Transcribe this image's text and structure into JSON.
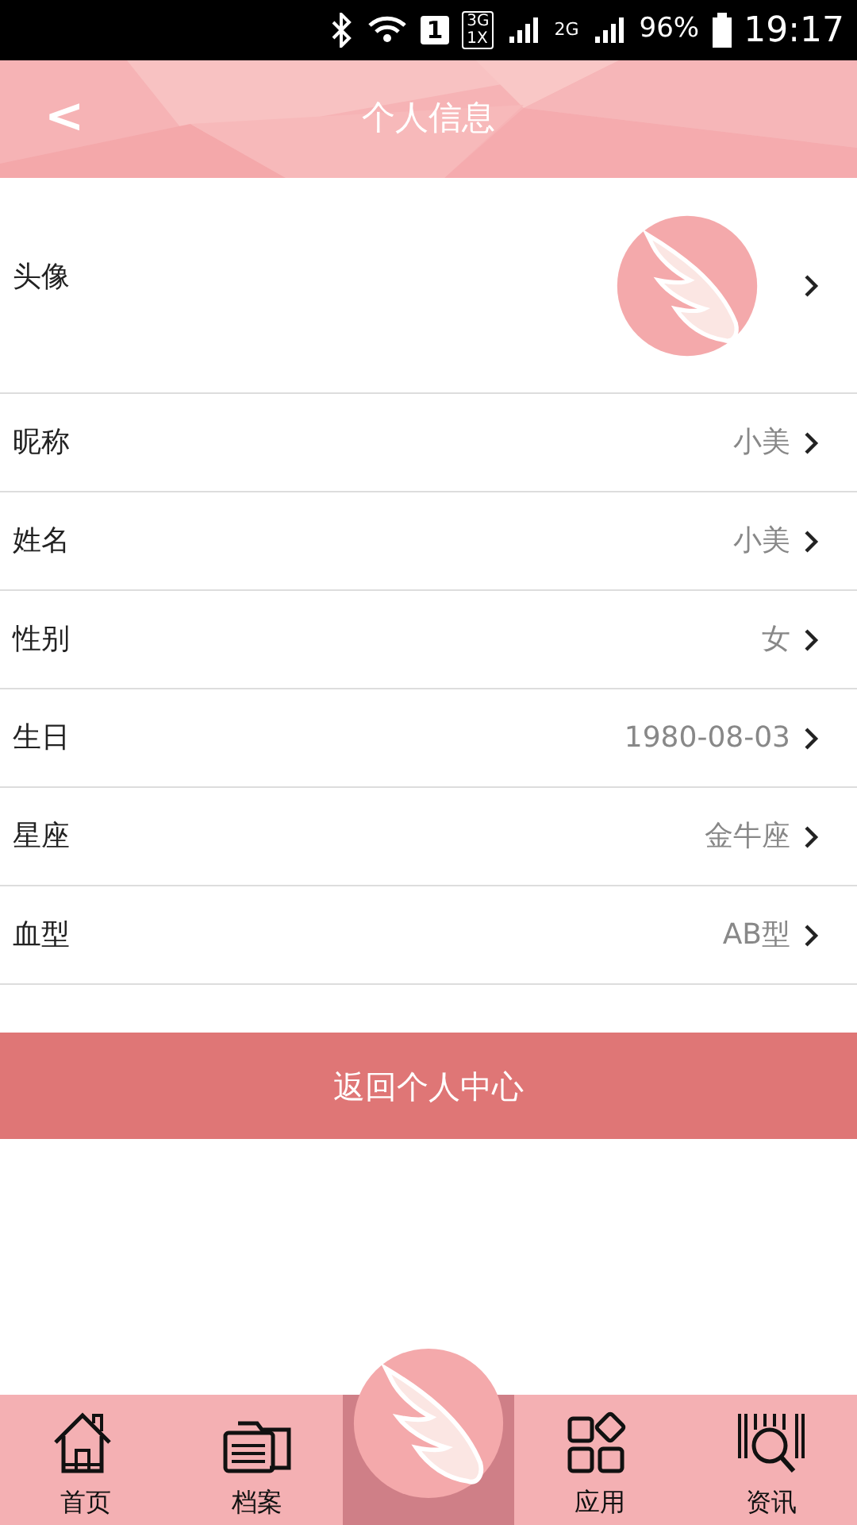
{
  "status_bar": {
    "sim": "1",
    "network_1": "3G",
    "network_2": "1X",
    "network_3": "2G",
    "battery": "96%",
    "time": "19:17"
  },
  "header": {
    "back": "<",
    "title": "个人信息"
  },
  "avatar_row": {
    "label": "头像"
  },
  "rows": [
    {
      "label": "昵称",
      "value": "小美"
    },
    {
      "label": "姓名",
      "value": "小美"
    },
    {
      "label": "性别",
      "value": "女"
    },
    {
      "label": "生日",
      "value": "1980-08-03"
    },
    {
      "label": "星座",
      "value": "金牛座"
    },
    {
      "label": "血型",
      "value": "AB型"
    }
  ],
  "return_button": "返回个人中心",
  "bottom_nav": [
    {
      "kind": "home",
      "label": "首页",
      "selected": false
    },
    {
      "kind": "folder",
      "label": "档案",
      "selected": false
    },
    {
      "kind": "logo",
      "selected": true
    },
    {
      "kind": "apps",
      "label": "应用",
      "selected": false
    },
    {
      "kind": "scan",
      "label": "资讯",
      "selected": false
    }
  ]
}
